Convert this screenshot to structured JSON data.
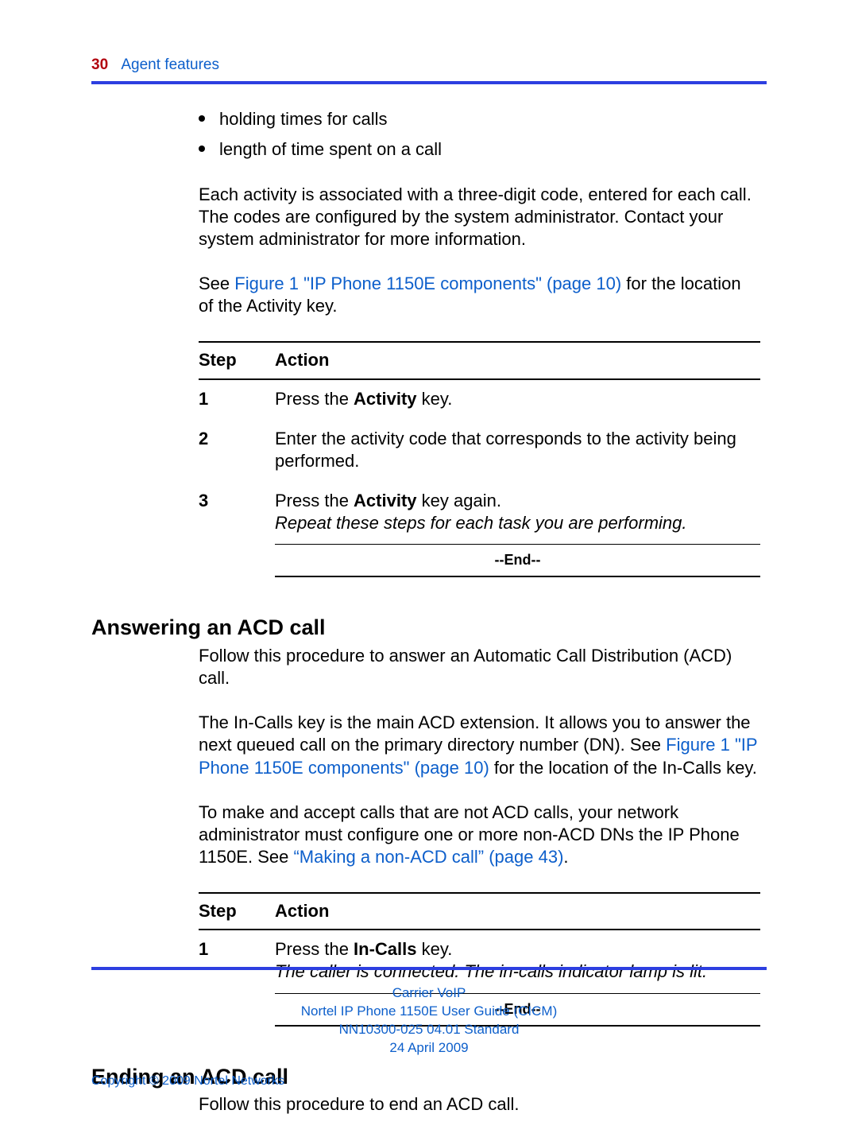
{
  "running_head": {
    "page_num": "30",
    "section": "Agent features"
  },
  "bullets": [
    "holding times for calls",
    "length of time spent on a call"
  ],
  "para1": "Each activity is associated with a three-digit code, entered for each call. The codes are configured by the system administrator. Contact your system administrator for more information.",
  "see_line": {
    "pre": "See ",
    "link": "Figure 1 \"IP Phone 1150E components\" (page 10)",
    "post": " for the location of the Activity key."
  },
  "step_hdr": {
    "step": "Step",
    "action": "Action"
  },
  "steps_a": [
    {
      "n": "1",
      "parts": [
        {
          "t": "Press the "
        },
        {
          "b": "Activity"
        },
        {
          "t": " key."
        }
      ]
    },
    {
      "n": "2",
      "parts": [
        {
          "t": "Enter the activity code that corresponds to the activity being performed."
        }
      ]
    },
    {
      "n": "3",
      "parts": [
        {
          "t": "Press the "
        },
        {
          "b": "Activity"
        },
        {
          "t": " key again."
        }
      ],
      "italic": "Repeat these steps for each task you are performing."
    }
  ],
  "end_label": "--End--",
  "sec_b": {
    "title": "Answering an ACD call"
  },
  "b_para1": "Follow this procedure to answer an Automatic Call Distribution (ACD) call.",
  "b_para2": {
    "pre": "The In-Calls key is the main ACD extension. It allows you to answer the next queued call on the primary directory number (DN). See ",
    "link": "Figure 1 \"IP Phone 1150E components\" (page 10)",
    "post": " for the location of the In-Calls key."
  },
  "b_para3": {
    "pre": "To make and accept calls that are not ACD calls, your network administrator must configure one or more non-ACD DNs the IP Phone 1150E. See ",
    "link": "“Making a non-ACD call” (page 43)",
    "post": "."
  },
  "steps_b": [
    {
      "n": "1",
      "parts": [
        {
          "t": "Press the "
        },
        {
          "b": "In-Calls"
        },
        {
          "t": " key."
        }
      ],
      "italic": "The caller is connected. The in-calls indicator lamp is lit."
    }
  ],
  "sec_c": {
    "title": "Ending an ACD call"
  },
  "c_para1": "Follow this procedure to end an ACD call.",
  "footer": {
    "l1": "Carrier VoIP",
    "l2": "Nortel IP Phone 1150E User Guide (CICM)",
    "l3": "NN10300-025   04.01   Standard",
    "l4": "24 April 2009"
  },
  "copyright": "Copyright © 2009 Nortel Networks"
}
